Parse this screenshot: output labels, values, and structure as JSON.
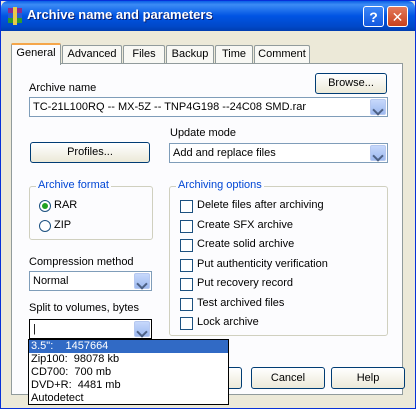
{
  "window": {
    "title": "Archive name and parameters"
  },
  "titlebar": {
    "help_label": "?",
    "close_label": "✕"
  },
  "tabs": [
    "General",
    "Advanced",
    "Files",
    "Backup",
    "Time",
    "Comment"
  ],
  "archive_name": {
    "label": "Archive name",
    "browse_label": "Browse...",
    "value": "TC-21L100RQ -- MX-5Z -- TNP4G198 --24C08 SMD.rar"
  },
  "profiles_label": "Profiles...",
  "update_mode": {
    "label": "Update mode",
    "value": "Add and replace files"
  },
  "archive_format": {
    "title": "Archive format",
    "options": [
      "RAR",
      "ZIP"
    ],
    "selected": "RAR"
  },
  "compression": {
    "label": "Compression method",
    "value": "Normal"
  },
  "split": {
    "label": "Split to volumes, bytes",
    "value": "|",
    "options": [
      "3.5\":    1457664",
      "Zip100:  98078 kb",
      "CD700:  700 mb",
      "DVD+R:  4481 mb",
      "Autodetect"
    ],
    "highlighted": 0
  },
  "archiving_options": {
    "title": "Archiving options",
    "items": [
      "Delete files after archiving",
      "Create SFX archive",
      "Create solid archive",
      "Put authenticity verification",
      "Put recovery record",
      "Test archived files",
      "Lock archive"
    ]
  },
  "buttons": {
    "cancel": "Cancel",
    "help": "Help"
  },
  "colors": {
    "titlebar": "#0054e3",
    "group_title": "#0046d5",
    "selection": "#316ac5"
  }
}
